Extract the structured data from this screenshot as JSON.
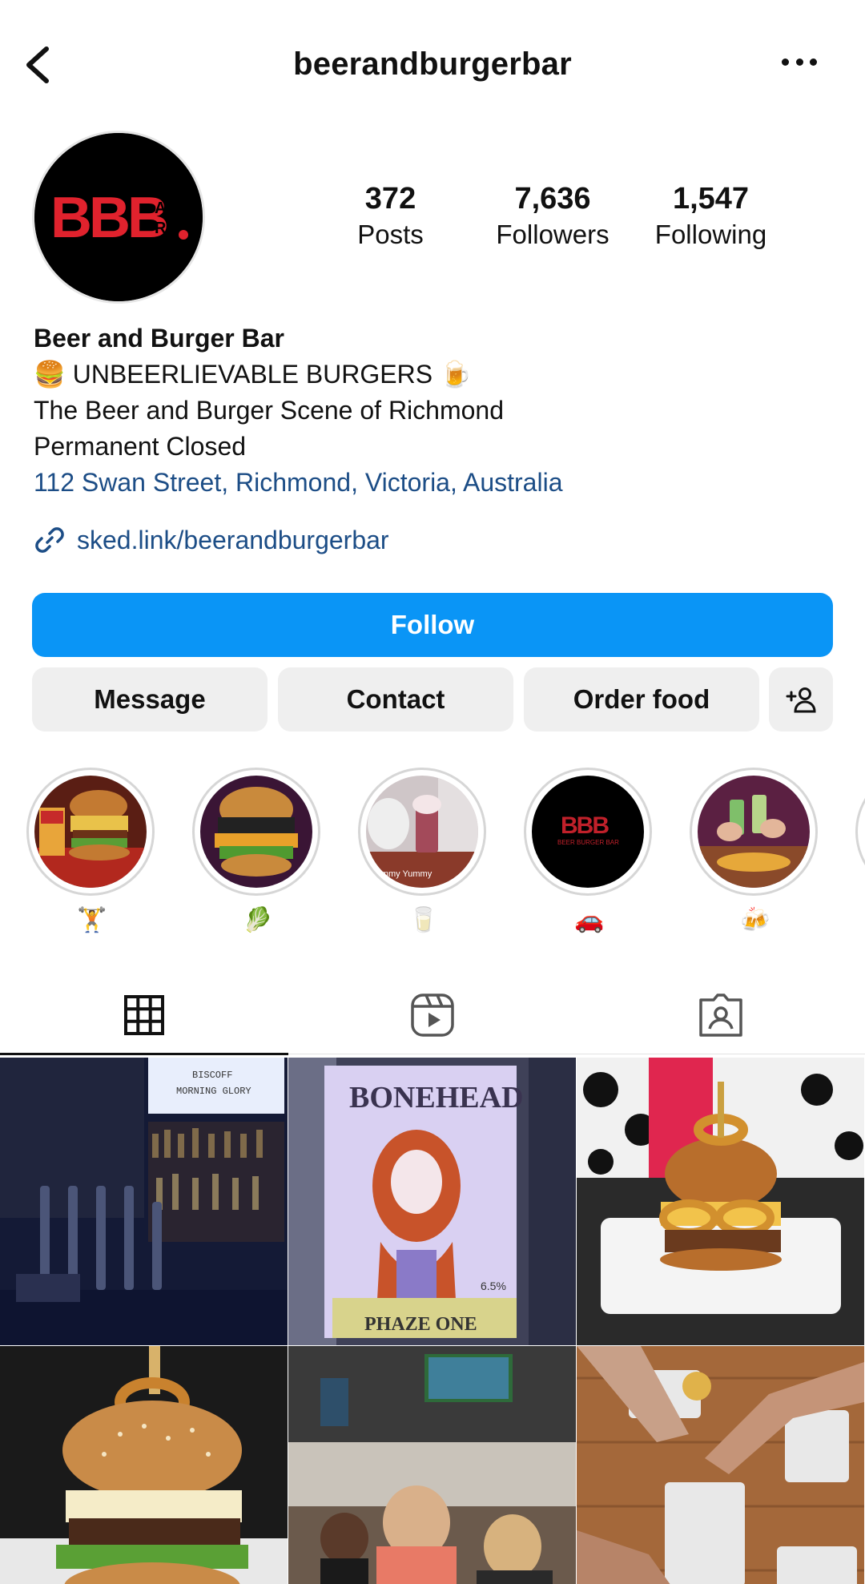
{
  "header": {
    "username": "beerandburgerbar"
  },
  "profile": {
    "avatar_text": "BBB",
    "stats": [
      {
        "value": "372",
        "label": "Posts"
      },
      {
        "value": "7,636",
        "label": "Followers"
      },
      {
        "value": "1,547",
        "label": "Following"
      }
    ],
    "bio": {
      "name": "Beer and Burger Bar",
      "tagline": "🍔 UNBEERLIEVABLE BURGERS 🍺",
      "line1": "The Beer and Burger Scene of Richmond",
      "line2": "Permanent Closed",
      "location": "112 Swan Street, Richmond, Victoria, Australia",
      "link": "sked.link/beerandburgerbar"
    }
  },
  "actions": {
    "follow": "Follow",
    "message": "Message",
    "contact": "Contact",
    "order_food": "Order food"
  },
  "highlights": [
    {
      "emoji": "🏋️"
    },
    {
      "emoji": "🥬"
    },
    {
      "emoji": "🥛"
    },
    {
      "emoji": "🚗"
    },
    {
      "emoji": "🍻"
    }
  ],
  "grid_texts": {
    "poster_title": "BONEHEAD",
    "poster_sub": "PHAZE ONE",
    "poster_abv": "6.5%",
    "bar_sign1": "BISCOFF",
    "bar_sign2": "MORNING GLORY",
    "highlight3_text": "Yummy Yummy",
    "highlight4_text": "BEER BURGER BAR"
  },
  "colors": {
    "accent": "#0a95f6",
    "link": "#1c4d86",
    "brand_red": "#e0222d"
  }
}
